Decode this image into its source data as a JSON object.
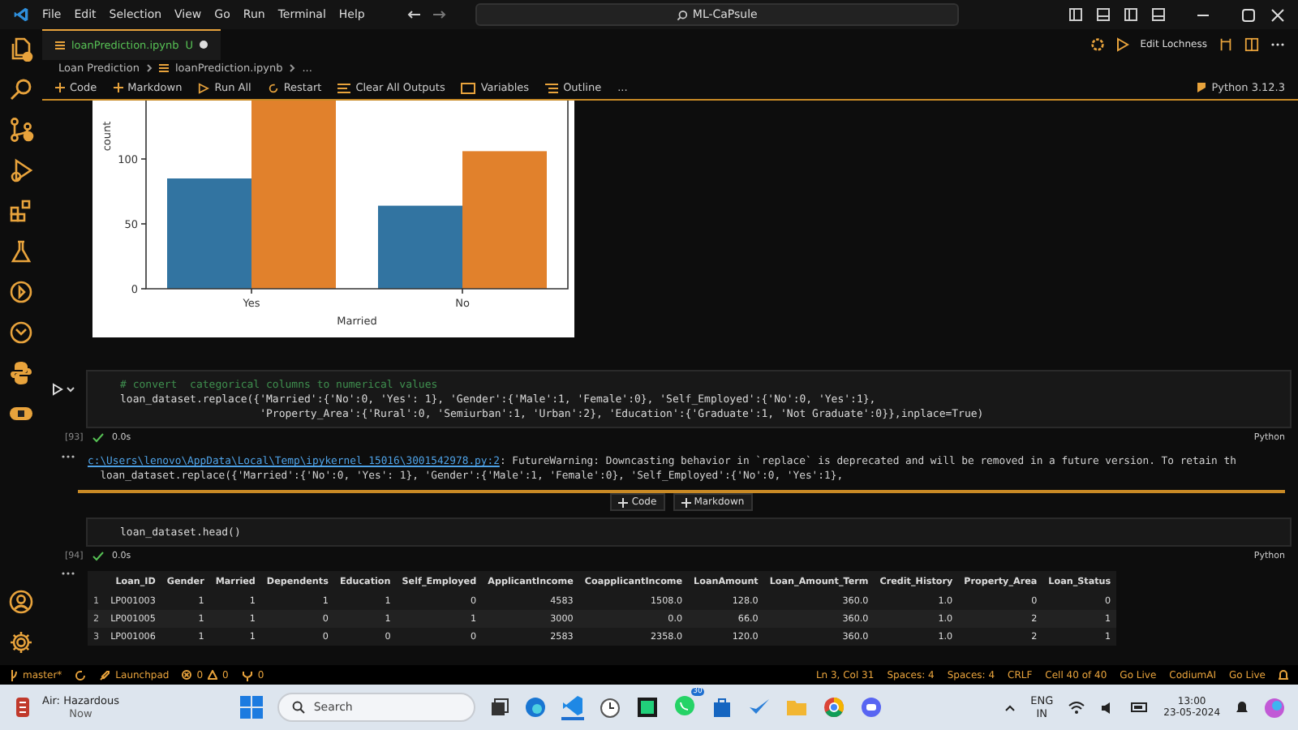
{
  "menu": [
    "File",
    "Edit",
    "Selection",
    "View",
    "Go",
    "Run",
    "Terminal",
    "Help"
  ],
  "command_center": {
    "value": "ML-CaPsule"
  },
  "tab": {
    "label": "loanPrediction.ipynb",
    "badge": "U",
    "modified": true
  },
  "editor_actions": {
    "label": "Edit Lochness"
  },
  "breadcrumbs": [
    "Loan Prediction",
    "loanPrediction.ipynb",
    "..."
  ],
  "toolbar": [
    {
      "kind": "plus",
      "label": "Code"
    },
    {
      "kind": "plus",
      "label": "Markdown"
    },
    {
      "kind": "run",
      "label": "Run All"
    },
    {
      "kind": "restart",
      "label": "Restart"
    },
    {
      "kind": "clear",
      "label": "Clear All Outputs"
    },
    {
      "kind": "variables",
      "label": "Variables"
    },
    {
      "kind": "outline",
      "label": "Outline"
    },
    {
      "kind": "more",
      "label": "..."
    }
  ],
  "kernel": "Python 3.12.3",
  "plot": {
    "chart_data": {
      "type": "bar",
      "xlabel": "Married",
      "ylabel": "count",
      "categories": [
        "Yes",
        "No"
      ],
      "series": [
        {
          "color": "#3274a1",
          "values": [
            85,
            64
          ]
        },
        {
          "color": "#e1812c",
          "values": [
            145,
            106
          ]
        }
      ],
      "ylim": [
        0,
        145
      ],
      "yticks": [
        0,
        50,
        100
      ]
    }
  },
  "cells": [
    {
      "lines": [
        {
          "kind": "comment",
          "text": "# convert  categorical columns to numerical values"
        },
        {
          "kind": "code",
          "text": "loan_dataset.replace({'Married':{'No':0, 'Yes': 1}, 'Gender':{'Male':1, 'Female':0}, 'Self_Employed':{'No':0, 'Yes':1},"
        },
        {
          "kind": "code",
          "text": "                      'Property_Area':{'Rural':0, 'Semiurban':1, 'Urban':2}, 'Education':{'Graduate':1, 'Not Graduate':0}},inplace=True)"
        }
      ],
      "count": "[93]",
      "time": "0.0s",
      "language": "Python"
    },
    {
      "lines": [
        {
          "kind": "code",
          "text": "loan_dataset.head()"
        }
      ],
      "count": "[94]",
      "time": "0.0s",
      "language": "Python"
    }
  ],
  "warning": {
    "path": "c:\\Users\\lenovo\\AppData\\Local\\Temp\\ipykernel_15016\\3001542978.py:2",
    "message": ": FutureWarning: Downcasting behavior in `replace` is deprecated and will be removed in a future version. To retain th",
    "source": "  loan_dataset.replace({'Married':{'No':0, 'Yes': 1}, 'Gender':{'Male':1, 'Female':0}, 'Self_Employed':{'No':0, 'Yes':1},"
  },
  "add_cell": [
    "Code",
    "Markdown"
  ],
  "table": {
    "columns": [
      "",
      "Loan_ID",
      "Gender",
      "Married",
      "Dependents",
      "Education",
      "Self_Employed",
      "ApplicantIncome",
      "CoapplicantIncome",
      "LoanAmount",
      "Loan_Amount_Term",
      "Credit_History",
      "Property_Area",
      "Loan_Status"
    ],
    "rows": [
      [
        "1",
        "LP001003",
        "1",
        "1",
        "1",
        "1",
        "0",
        "4583",
        "1508.0",
        "128.0",
        "360.0",
        "1.0",
        "0",
        "0"
      ],
      [
        "2",
        "LP001005",
        "1",
        "1",
        "0",
        "1",
        "1",
        "3000",
        "0.0",
        "66.0",
        "360.0",
        "1.0",
        "2",
        "1"
      ],
      [
        "3",
        "LP001006",
        "1",
        "1",
        "0",
        "0",
        "0",
        "2583",
        "2358.0",
        "120.0",
        "360.0",
        "1.0",
        "2",
        "1"
      ]
    ]
  },
  "status_left": [
    {
      "kind": "branch",
      "label": "master*"
    },
    {
      "kind": "sync"
    },
    {
      "kind": "launch",
      "label": "Launchpad"
    },
    {
      "kind": "problems",
      "label": "0",
      "label2": "0"
    },
    {
      "kind": "ports",
      "label": "0"
    }
  ],
  "status_right": [
    "Ln 3, Col 31",
    "Spaces: 4",
    "Spaces: 4",
    "CRLF",
    "Cell 40 of 40",
    "Go Live",
    "CodiumAI",
    "Go Live"
  ],
  "taskbar": {
    "weather": {
      "title": "Air: Hazardous",
      "subtitle": "Now"
    },
    "search": {
      "placeholder": "Search"
    },
    "badge": "30",
    "language": [
      "ENG",
      "IN"
    ],
    "time": "13:00",
    "date": "23-05-2024"
  }
}
